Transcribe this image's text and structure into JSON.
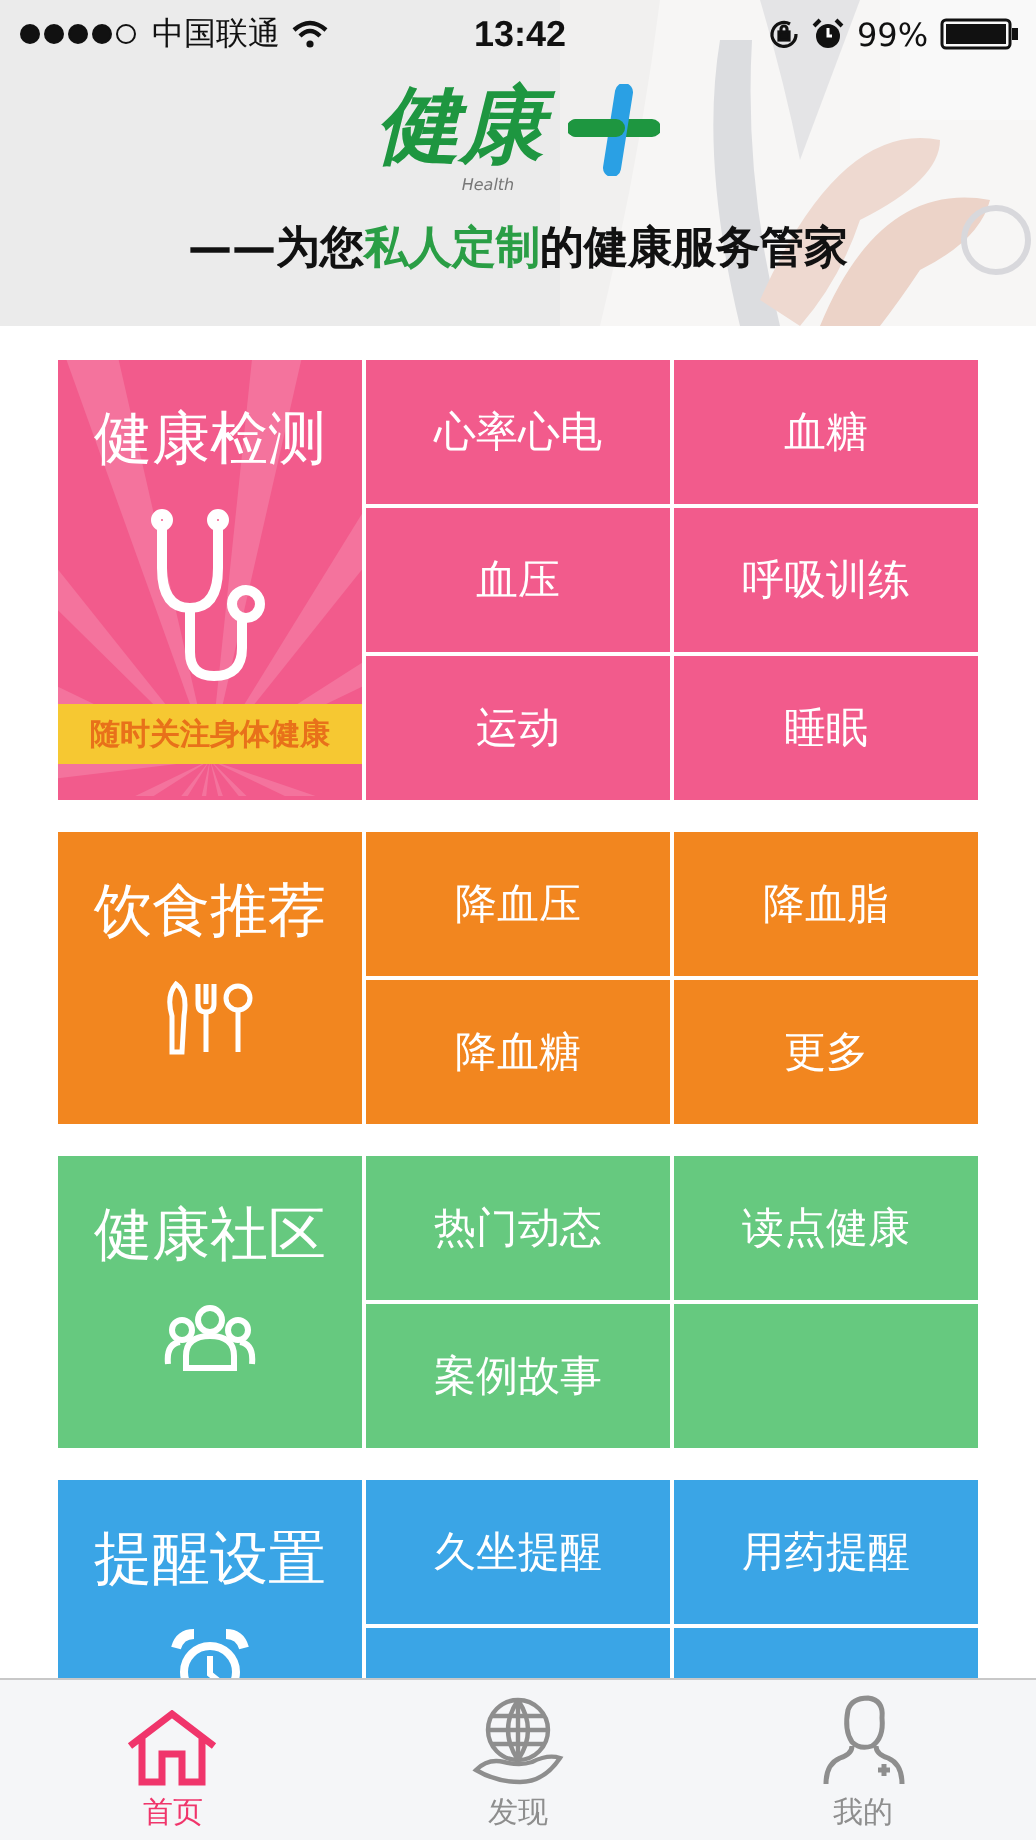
{
  "status_bar": {
    "carrier": "中国联通",
    "time": "13:42",
    "battery": "99%"
  },
  "header": {
    "logo": "健康",
    "logo_sub": "Health",
    "tagline": [
      {
        "text": "——为您",
        "highlight": false
      },
      {
        "text": "私人定制",
        "highlight": true
      },
      {
        "text": "的健康服务管家",
        "highlight": false
      }
    ]
  },
  "sections": [
    {
      "title": "健康检测",
      "color": "#f25b8c",
      "kind": "stethoscope",
      "banner": "随时关注身体健康",
      "items": [
        {
          "label": "心率心电"
        },
        {
          "label": "血糖"
        },
        {
          "label": "血压"
        },
        {
          "label": "呼吸训练"
        },
        {
          "label": "运动"
        },
        {
          "label": "睡眠"
        }
      ]
    },
    {
      "title": "饮食推荐",
      "color": "#f2861f",
      "kind": "utensils",
      "items": [
        {
          "label": "降血压"
        },
        {
          "label": "降血脂"
        },
        {
          "label": "降血糖"
        },
        {
          "label": "更多"
        }
      ]
    },
    {
      "title": "健康社区",
      "color": "#66c97f",
      "kind": "people",
      "items": [
        {
          "label": "热门动态"
        },
        {
          "label": "读点健康"
        },
        {
          "label": "案例故事"
        }
      ]
    },
    {
      "title": "提醒设置",
      "color": "#3aa5e6",
      "kind": "alarm",
      "items": [
        {
          "label": "久坐提醒"
        },
        {
          "label": "用药提醒"
        }
      ]
    }
  ],
  "tab_bar": [
    {
      "label": "首页",
      "kind": "home",
      "selected": true
    },
    {
      "label": "发现",
      "kind": "globe",
      "selected": false
    },
    {
      "label": "我的",
      "kind": "user",
      "selected": false
    }
  ]
}
